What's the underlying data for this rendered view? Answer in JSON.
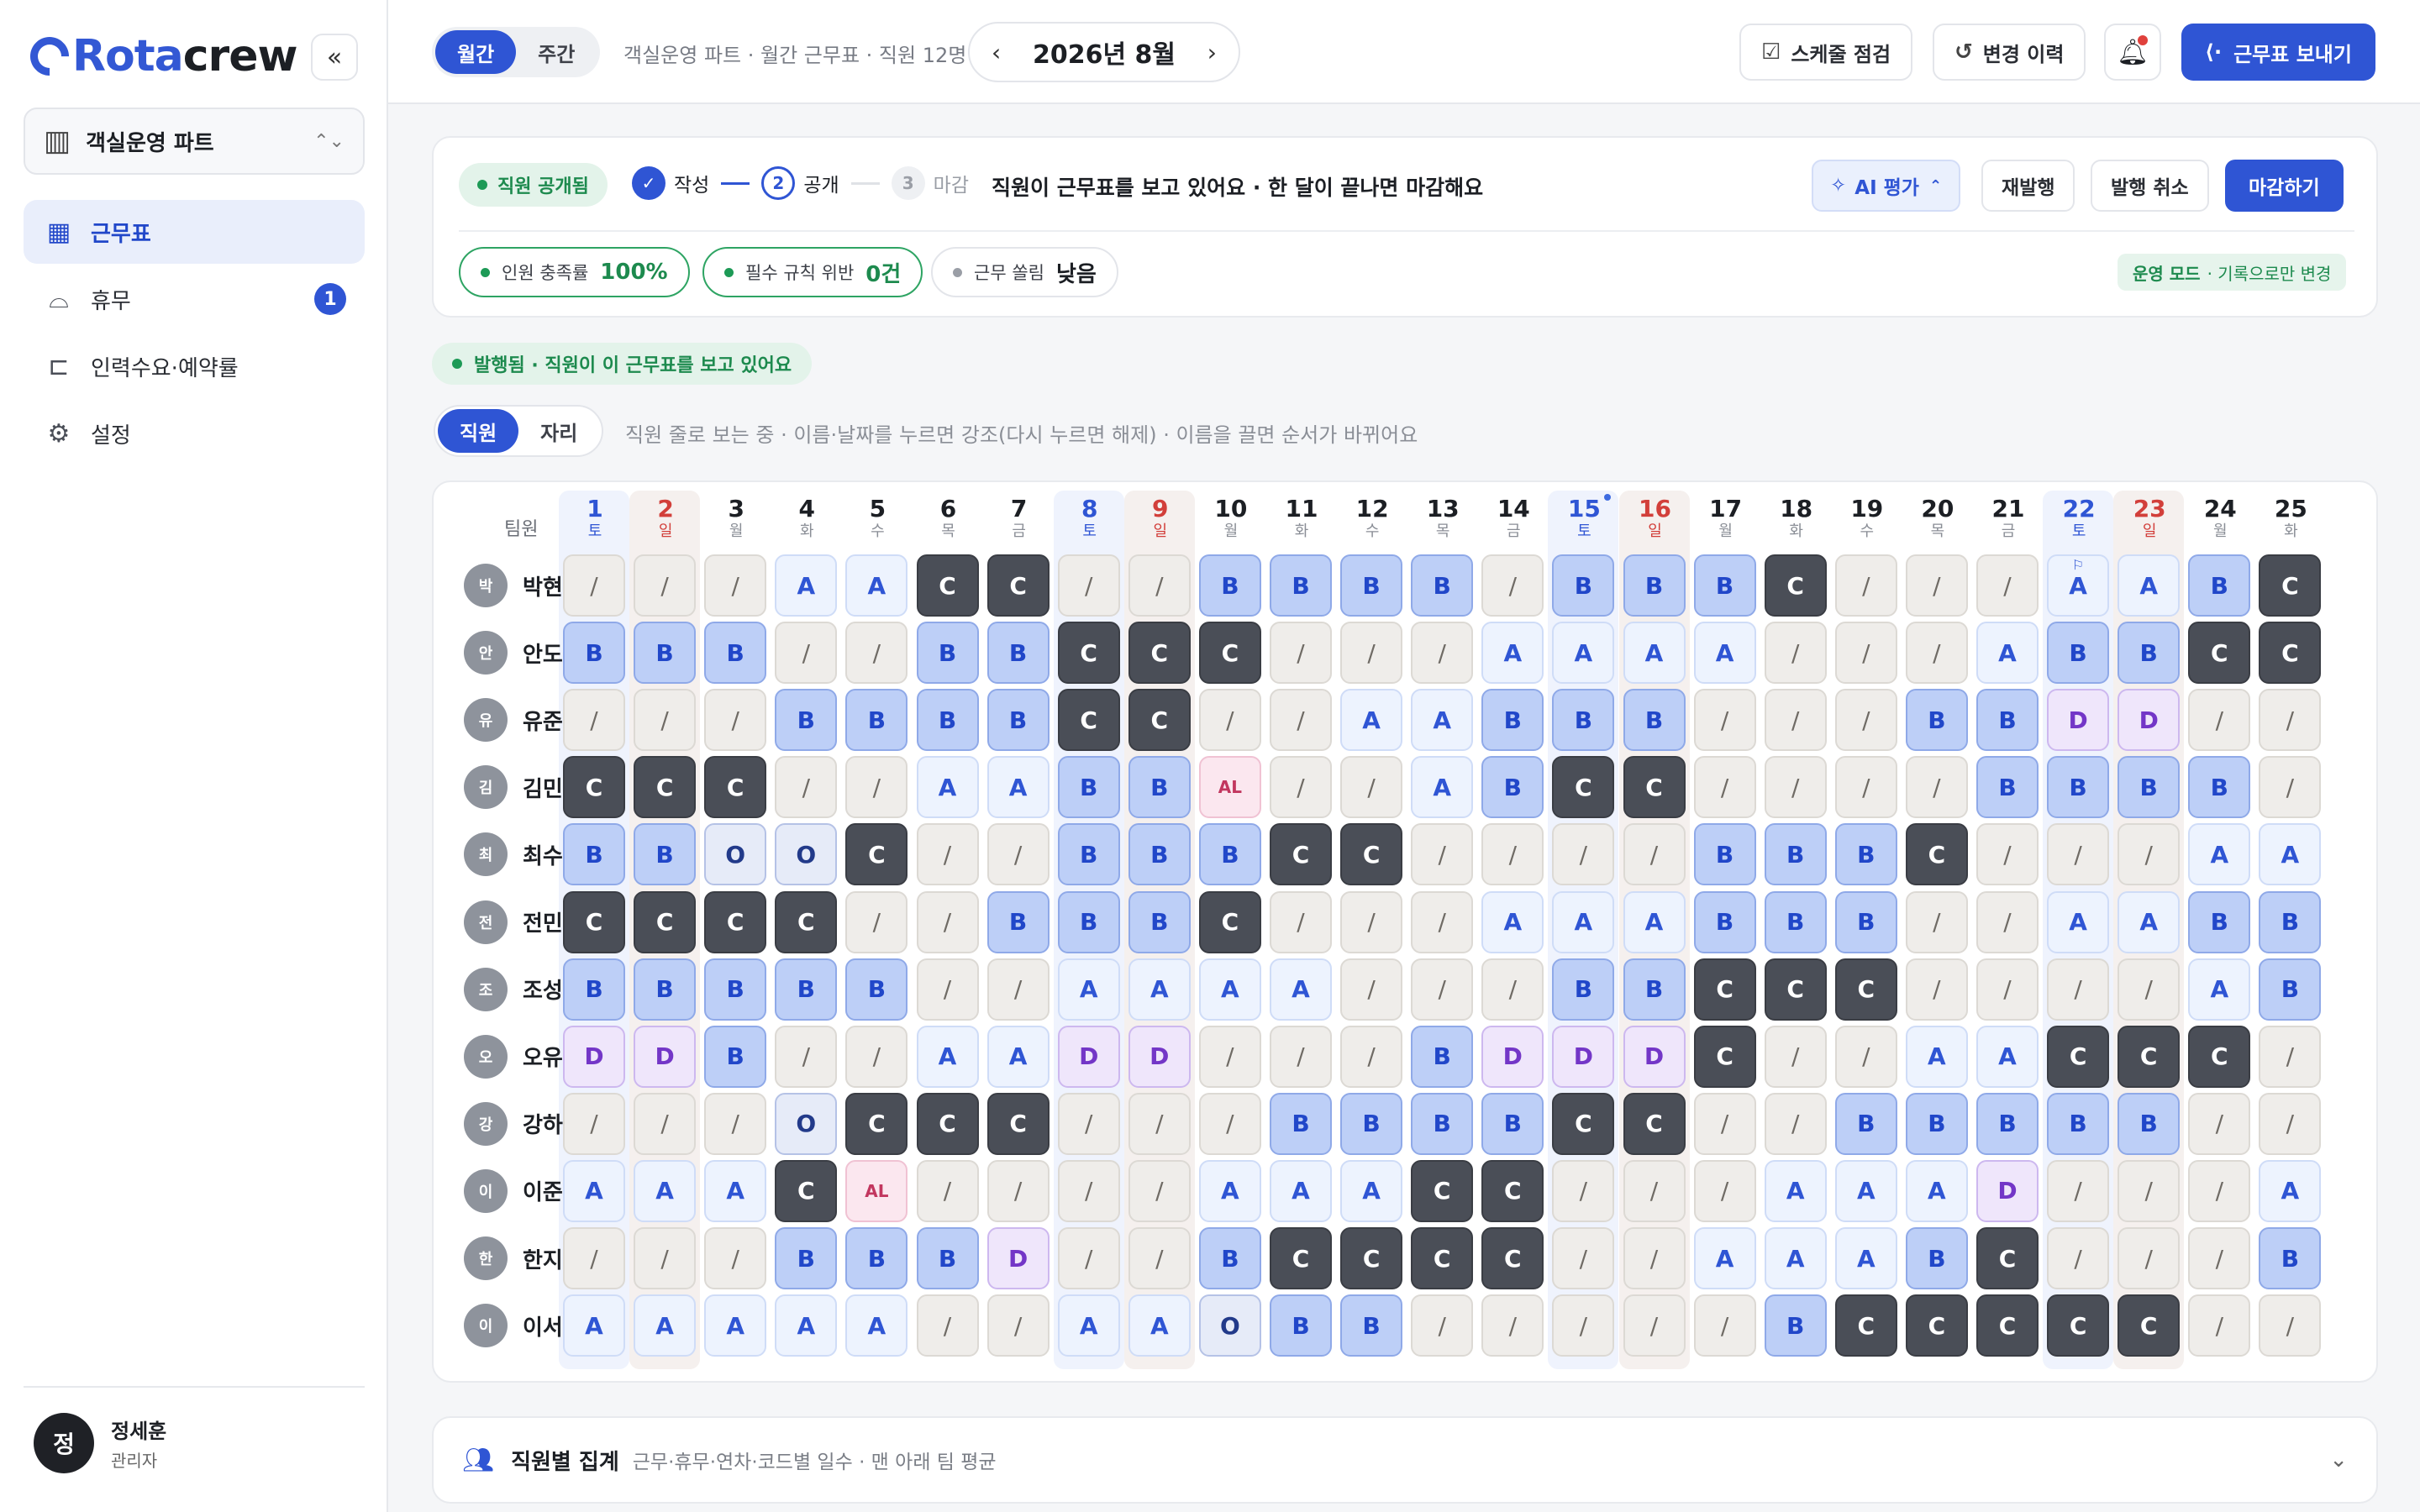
{
  "brand": {
    "name_a": "Rota",
    "name_b": "crew"
  },
  "sidebar": {
    "collapse_icon": "«",
    "part_select": {
      "label": "객실운영 파트"
    },
    "items": [
      {
        "label": "근무표",
        "icon": "calendar-icon",
        "glyph": "▦",
        "active": true,
        "badge": ""
      },
      {
        "label": "휴무",
        "icon": "inbox-icon",
        "glyph": "⌓",
        "active": false,
        "badge": "1"
      },
      {
        "label": "인력수요·예약률",
        "icon": "bed-icon",
        "glyph": "⊏",
        "active": false,
        "badge": ""
      },
      {
        "label": "설정",
        "icon": "gear-icon",
        "glyph": "⚙",
        "active": false,
        "badge": ""
      }
    ],
    "user": {
      "initial": "정",
      "name": "정세훈",
      "role": "관리자"
    }
  },
  "topbar": {
    "seg_monthly": "월간",
    "seg_weekly": "주간",
    "subtitle": "객실운영 파트 · 월간 근무표 · 직원 12명",
    "month": "2026년 8월",
    "prev": "‹",
    "next": "›",
    "schedule_check": "스케줄 점검",
    "history": "변경 이력",
    "send": "근무표 보내기"
  },
  "status": {
    "published_pill": "직원 공개됨",
    "steps": [
      {
        "num": "✓",
        "label": "작성",
        "state": "done"
      },
      {
        "num": "2",
        "label": "공개",
        "state": "current"
      },
      {
        "num": "3",
        "label": "마감",
        "state": "todo"
      }
    ],
    "message": "직원이 근무표를 보고 있어요 · 한 달이 끝나면 마감해요",
    "ai_eval": "AI 평가",
    "republish": "재발행",
    "unpublish": "발행 취소",
    "close": "마감하기",
    "metrics": [
      {
        "label": "인원 충족률",
        "value": "100%",
        "ok": true
      },
      {
        "label": "필수 규칙 위반",
        "value": "0건",
        "ok": true
      },
      {
        "label": "근무 쏠림",
        "value": "낮음",
        "ok": false
      }
    ],
    "mode_bold": "운영 모드",
    "mode_rest": "· 기록으로만 변경"
  },
  "banner": "발행됨 · 직원이 이 근무표를 보고 있어요",
  "view": {
    "staff": "직원",
    "seat": "자리",
    "hint": "직원 줄로 보는 중 · 이름·날짜를 누르면 강조(다시 누르면 해제) · 이름을 끌면 순서가 바뀌어요"
  },
  "grid": {
    "team_header": "팀원",
    "days": [
      {
        "d": "1",
        "w": "토"
      },
      {
        "d": "2",
        "w": "일"
      },
      {
        "d": "3",
        "w": "월"
      },
      {
        "d": "4",
        "w": "화"
      },
      {
        "d": "5",
        "w": "수"
      },
      {
        "d": "6",
        "w": "목"
      },
      {
        "d": "7",
        "w": "금"
      },
      {
        "d": "8",
        "w": "토"
      },
      {
        "d": "9",
        "w": "일"
      },
      {
        "d": "10",
        "w": "월"
      },
      {
        "d": "11",
        "w": "화"
      },
      {
        "d": "12",
        "w": "수"
      },
      {
        "d": "13",
        "w": "목"
      },
      {
        "d": "14",
        "w": "금"
      },
      {
        "d": "15",
        "w": "토",
        "holiday": true
      },
      {
        "d": "16",
        "w": "일"
      },
      {
        "d": "17",
        "w": "월"
      },
      {
        "d": "18",
        "w": "화"
      },
      {
        "d": "19",
        "w": "수"
      },
      {
        "d": "20",
        "w": "목"
      },
      {
        "d": "21",
        "w": "금"
      },
      {
        "d": "22",
        "w": "토"
      },
      {
        "d": "23",
        "w": "일"
      },
      {
        "d": "24",
        "w": "월"
      },
      {
        "d": "25",
        "w": "화"
      }
    ],
    "rows": [
      {
        "initial": "박",
        "name": "박현우",
        "cells": [
          "/",
          "/",
          "/",
          "A",
          "A",
          "C",
          "C",
          "/",
          "/",
          "B",
          "B",
          "B",
          "B",
          "/",
          "B",
          "B",
          "B",
          "C",
          "/",
          "/",
          "/",
          "A",
          "A",
          "B",
          "C"
        ],
        "marks": {
          "21": "⚐"
        }
      },
      {
        "initial": "안",
        "name": "안도윤",
        "cells": [
          "B",
          "B",
          "B",
          "/",
          "/",
          "B",
          "B",
          "C",
          "C",
          "C",
          "/",
          "/",
          "/",
          "A",
          "A",
          "A",
          "A",
          "/",
          "/",
          "/",
          "A",
          "B",
          "B",
          "C",
          "C"
        ]
      },
      {
        "initial": "유",
        "name": "유준호",
        "cells": [
          "/",
          "/",
          "/",
          "B",
          "B",
          "B",
          "B",
          "C",
          "C",
          "/",
          "/",
          "A",
          "A",
          "B",
          "B",
          "B",
          "/",
          "/",
          "/",
          "B",
          "B",
          "D",
          "D",
          "/",
          "/"
        ]
      },
      {
        "initial": "김",
        "name": "김민준",
        "cells": [
          "C",
          "C",
          "C",
          "/",
          "/",
          "A",
          "A",
          "B",
          "B",
          "AL",
          "/",
          "/",
          "A",
          "B",
          "C",
          "C",
          "/",
          "/",
          "/",
          "/",
          "B",
          "B",
          "B",
          "B",
          "/"
        ]
      },
      {
        "initial": "최",
        "name": "최수아",
        "cells": [
          "B",
          "B",
          "O",
          "O",
          "C",
          "/",
          "/",
          "B",
          "B",
          "B",
          "C",
          "C",
          "/",
          "/",
          "/",
          "/",
          "B",
          "B",
          "B",
          "C",
          "/",
          "/",
          "/",
          "A",
          "A"
        ]
      },
      {
        "initial": "전",
        "name": "전민재",
        "cells": [
          "C",
          "C",
          "C",
          "C",
          "/",
          "/",
          "B",
          "B",
          "B",
          "C",
          "/",
          "/",
          "/",
          "A",
          "A",
          "A",
          "B",
          "B",
          "B",
          "/",
          "/",
          "A",
          "A",
          "B",
          "B"
        ]
      },
      {
        "initial": "조",
        "name": "조성민",
        "cells": [
          "B",
          "B",
          "B",
          "B",
          "B",
          "/",
          "/",
          "A",
          "A",
          "A",
          "A",
          "/",
          "/",
          "/",
          "B",
          "B",
          "C",
          "C",
          "C",
          "/",
          "/",
          "/",
          "/",
          "A",
          "B"
        ]
      },
      {
        "initial": "오",
        "name": "오유진",
        "cells": [
          "D",
          "D",
          "B",
          "/",
          "/",
          "A",
          "A",
          "D",
          "D",
          "/",
          "/",
          "/",
          "B",
          "D",
          "D",
          "D",
          "C",
          "/",
          "/",
          "A",
          "A",
          "C",
          "C",
          "C",
          "/"
        ]
      },
      {
        "initial": "강",
        "name": "강하윤",
        "cells": [
          "/",
          "/",
          "/",
          "O",
          "C",
          "C",
          "C",
          "/",
          "/",
          "/",
          "B",
          "B",
          "B",
          "B",
          "C",
          "C",
          "/",
          "/",
          "B",
          "B",
          "B",
          "B",
          "B",
          "/",
          "/"
        ]
      },
      {
        "initial": "이",
        "name": "이준서",
        "cells": [
          "A",
          "A",
          "A",
          "C",
          "AL",
          "/",
          "/",
          "/",
          "/",
          "A",
          "A",
          "A",
          "C",
          "C",
          "/",
          "/",
          "/",
          "A",
          "A",
          "A",
          "D",
          "/",
          "/",
          "/",
          "A"
        ]
      },
      {
        "initial": "한",
        "name": "한지우",
        "cells": [
          "/",
          "/",
          "/",
          "B",
          "B",
          "B",
          "D",
          "/",
          "/",
          "B",
          "C",
          "C",
          "C",
          "C",
          "/",
          "/",
          "A",
          "A",
          "A",
          "B",
          "C",
          "/",
          "/",
          "/",
          "B"
        ]
      },
      {
        "initial": "이",
        "name": "이서연",
        "cells": [
          "A",
          "A",
          "A",
          "A",
          "A",
          "/",
          "/",
          "A",
          "A",
          "O",
          "B",
          "B",
          "/",
          "/",
          "/",
          "/",
          "/",
          "B",
          "C",
          "C",
          "C",
          "C",
          "C",
          "/",
          "/"
        ]
      }
    ]
  },
  "summary": {
    "title": "직원별 집계",
    "subtitle": "근무·휴무·연차·코드별 일수 · 맨 아래 팀 평균"
  },
  "colors": {
    "accent": "#2f55d4",
    "success": "#1d8a4e",
    "sunday": "#d23f3a",
    "saturday": "#2f55d4"
  }
}
